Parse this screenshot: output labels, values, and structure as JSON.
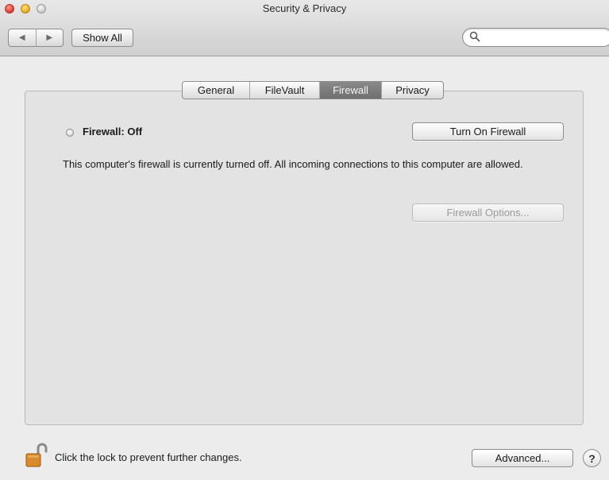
{
  "window": {
    "title": "Security & Privacy"
  },
  "toolbar": {
    "back_icon": "◀",
    "forward_icon": "▶",
    "show_all_label": "Show All",
    "search": {
      "value": "",
      "placeholder": ""
    }
  },
  "tabs": [
    {
      "label": "General",
      "selected": false
    },
    {
      "label": "FileVault",
      "selected": false
    },
    {
      "label": "Firewall",
      "selected": true
    },
    {
      "label": "Privacy",
      "selected": false
    }
  ],
  "firewall": {
    "status_label": "Firewall: Off",
    "turn_on_label": "Turn On Firewall",
    "description": "This computer's firewall is currently turned off. All incoming connections to this computer are allowed.",
    "options_label": "Firewall Options..."
  },
  "footer": {
    "lock_label": "Click the lock to prevent further changes.",
    "advanced_label": "Advanced...",
    "help_label": "?"
  },
  "colors": {
    "window_bg": "#ececec",
    "panel_bg": "#e3e3e3",
    "selected_tab": "#7c7c7c",
    "close": "#e0443a",
    "minimize": "#eab02a",
    "lock": "#d98a2a"
  }
}
